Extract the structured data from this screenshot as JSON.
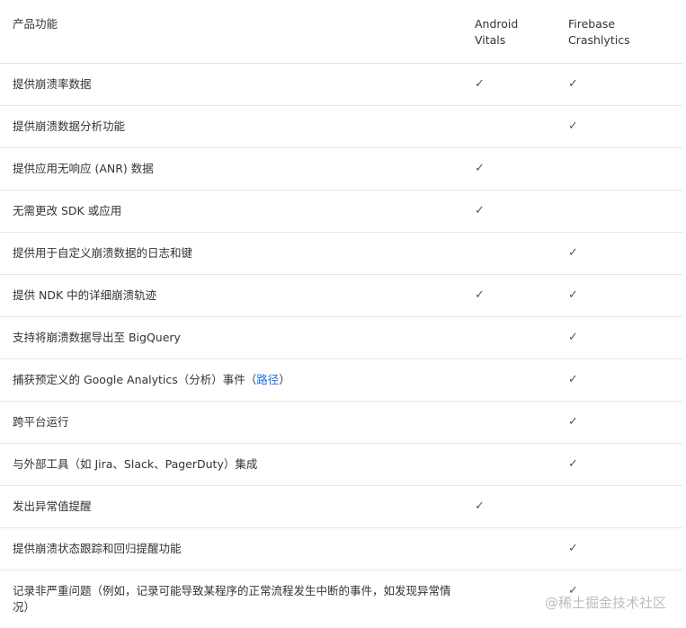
{
  "header": {
    "feature_label": "产品功能",
    "col_a": "Android\nVitals",
    "col_b": "Firebase\nCrashlytics"
  },
  "check_glyph": "✓",
  "rows": [
    {
      "feature": "提供崩溃率数据",
      "a": "✓",
      "b": "✓"
    },
    {
      "feature": "提供崩溃数据分析功能",
      "a": "",
      "b": "✓"
    },
    {
      "feature": "提供应用无响应 (ANR) 数据",
      "a": "✓",
      "b": ""
    },
    {
      "feature": "无需更改 SDK 或应用",
      "a": "✓",
      "b": ""
    },
    {
      "feature": "提供用于自定义崩溃数据的日志和键",
      "a": "",
      "b": "✓"
    },
    {
      "feature": "提供 NDK 中的详细崩溃轨迹",
      "a": "✓",
      "b": "✓"
    },
    {
      "feature": "支持将崩溃数据导出至 BigQuery",
      "a": "",
      "b": "✓"
    },
    {
      "feature_pre": "捕获预定义的 Google Analytics（分析）事件（",
      "feature_link": "路径",
      "feature_post": "）",
      "a": "",
      "b": "✓"
    },
    {
      "feature": "跨平台运行",
      "a": "",
      "b": "✓"
    },
    {
      "feature": "与外部工具（如 Jira、Slack、PagerDuty）集成",
      "a": "",
      "b": "✓"
    },
    {
      "feature": "发出异常值提醒",
      "a": "✓",
      "b": ""
    },
    {
      "feature": "提供崩溃状态跟踪和回归提醒功能",
      "a": "",
      "b": "✓"
    },
    {
      "feature": "记录非严重问题（例如，记录可能导致某程序的正常流程发生中断的事件，如发现异常情况）",
      "a": "",
      "b": "✓"
    }
  ],
  "watermark": "@稀土掘金技术社区"
}
